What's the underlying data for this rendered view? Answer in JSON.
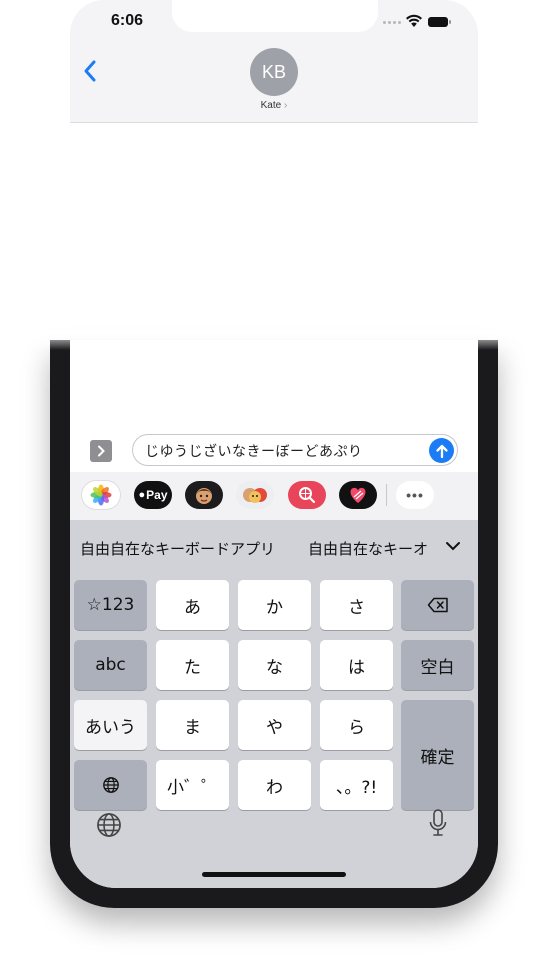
{
  "status_bar": {
    "time": "6:06"
  },
  "header": {
    "avatar_initials": "KB",
    "contact_name": "Kate",
    "contact_chevron": "›"
  },
  "message_input": {
    "value": "じゆうじざいなきーぼーどあぷり",
    "send_icon": "arrow-up-icon"
  },
  "apps_bar": {
    "items": [
      {
        "name": "photos",
        "label": ""
      },
      {
        "name": "apple-pay",
        "label": "Pay"
      },
      {
        "name": "memoji",
        "label": ""
      },
      {
        "name": "memoji-stickers",
        "label": ""
      },
      {
        "name": "images-search",
        "label": ""
      },
      {
        "name": "digital-touch",
        "label": ""
      },
      {
        "name": "more",
        "label": "•••"
      }
    ]
  },
  "candidates": {
    "first": "自由自在なキーボードアプリ",
    "second": "自由自在なキーオ"
  },
  "keyboard": {
    "left_col": [
      "☆123",
      "abc",
      "あいう"
    ],
    "keys": [
      "あ",
      "か",
      "さ",
      "た",
      "な",
      "は",
      "ま",
      "や",
      "ら",
      "小゛゜",
      "わ",
      "、。?!"
    ],
    "space": "空白",
    "confirm": "確定"
  },
  "colors": {
    "accent": "#1b7cf5",
    "keyboard_bg": "#d1d2d8"
  }
}
